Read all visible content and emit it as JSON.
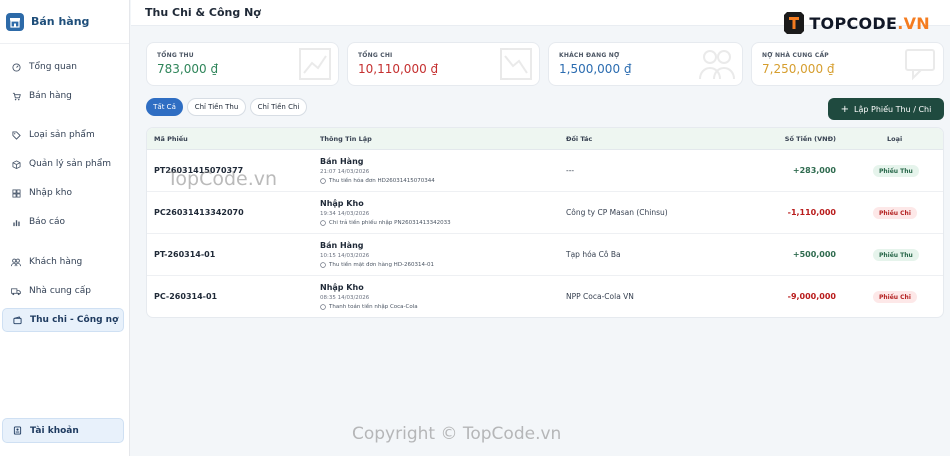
{
  "brand": {
    "title": "Bán hàng"
  },
  "sidebar": {
    "items": [
      {
        "label": "Tổng quan",
        "icon": "gauge-icon"
      },
      {
        "label": "Bán hàng",
        "icon": "cart-icon"
      },
      {
        "label": "Loại sản phẩm",
        "icon": "tag-icon"
      },
      {
        "label": "Quản lý sản phẩm",
        "icon": "box-icon"
      },
      {
        "label": "Nhập kho",
        "icon": "warehouse-icon"
      },
      {
        "label": "Báo cáo",
        "icon": "chart-icon"
      },
      {
        "label": "Khách hàng",
        "icon": "users-icon"
      },
      {
        "label": "Nhà cung cấp",
        "icon": "truck-icon"
      },
      {
        "label": "Thu chi - Công nợ",
        "icon": "wallet-icon"
      }
    ],
    "account": {
      "label": "Tài khoản",
      "icon": "id-card-icon"
    }
  },
  "header": {
    "title": "Thu Chi & Công Nợ",
    "watermark_logo_main": "TOPCODE",
    "watermark_logo_suffix": ".VN"
  },
  "stats": [
    {
      "label": "TỔNG THU",
      "value": "783,000 ₫",
      "color": "#2f855a"
    },
    {
      "label": "TỔNG CHI",
      "value": "10,110,000 ₫",
      "color": "#c53030"
    },
    {
      "label": "KHÁCH ĐANG NỢ",
      "value": "1,500,000 ₫",
      "color": "#2b6cb0"
    },
    {
      "label": "NỢ NHÀ CUNG CẤP",
      "value": "7,250,000 ₫",
      "color": "#d69e2e"
    }
  ],
  "filters": [
    {
      "label": "Tất Cả",
      "active": true
    },
    {
      "label": "Chỉ Tiền Thu",
      "active": false
    },
    {
      "label": "Chỉ Tiền Chi",
      "active": false
    }
  ],
  "create_button": {
    "label": "Lập Phiếu Thu / Chi"
  },
  "table": {
    "headers": [
      "Mã Phiếu",
      "Thông Tin Lập",
      "Đối Tác",
      "Số Tiền (VNĐ)",
      "Loại"
    ],
    "rows": [
      {
        "code": "PT26031415070377",
        "title": "Bán Hàng",
        "time": "21:07 14/03/2026",
        "note": "Thu tiền hóa đơn HD26031415070344",
        "partner": "---",
        "amount": "+283,000",
        "type": "Phiếu Thu"
      },
      {
        "code": "PC26031413342070",
        "title": "Nhập Kho",
        "time": "19:34 14/03/2026",
        "note": "Chi trả tiền phiếu nhập PN26031413342033",
        "partner": "Công ty CP Masan (Chinsu)",
        "amount": "-1,110,000",
        "type": "Phiếu Chi"
      },
      {
        "code": "PT-260314-01",
        "title": "Bán Hàng",
        "time": "10:15 14/03/2026",
        "note": "Thu tiền mặt đơn hàng HD-260314-01",
        "partner": "Tạp hóa Cô Ba",
        "amount": "+500,000",
        "type": "Phiếu Thu"
      },
      {
        "code": "PC-260314-01",
        "title": "Nhập Kho",
        "time": "08:35 14/03/2026",
        "note": "Thanh toán tiền nhập Coca-Cola",
        "partner": "NPP Coca-Cola VN",
        "amount": "-9,000,000",
        "type": "Phiếu Chi"
      }
    ]
  },
  "watermarks": {
    "middle": "TopCode.vn",
    "bottom": "Copyright © TopCode.vn"
  }
}
